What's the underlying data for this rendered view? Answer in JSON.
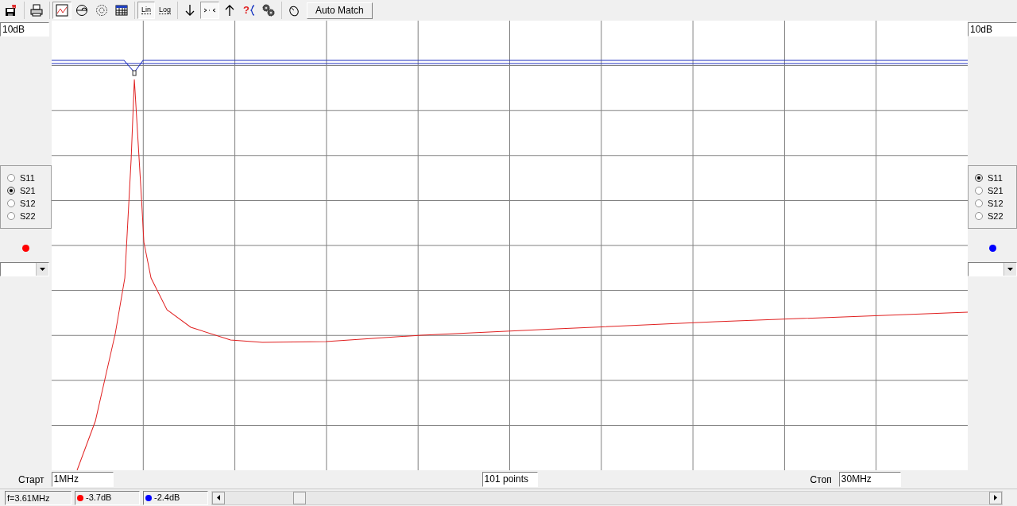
{
  "toolbar": {
    "groups": [
      [
        {
          "kind": "save",
          "selected": false
        }
      ],
      [
        {
          "kind": "print",
          "selected": false
        }
      ],
      [
        {
          "kind": "chart",
          "selected": true
        },
        {
          "kind": "smith",
          "selected": false
        },
        {
          "kind": "polar",
          "selected": false
        },
        {
          "kind": "table",
          "selected": false
        }
      ],
      [
        {
          "kind": "lin",
          "label": "Lin",
          "selected": true
        },
        {
          "kind": "log",
          "label": "Log",
          "selected": false
        }
      ],
      [
        {
          "kind": "down",
          "selected": false
        },
        {
          "kind": "fit",
          "selected": true
        },
        {
          "kind": "up",
          "selected": false
        },
        {
          "kind": "help",
          "label": "?",
          "selected": false
        },
        {
          "kind": "gears",
          "selected": false
        }
      ],
      [
        {
          "kind": "mouse",
          "selected": false
        }
      ]
    ],
    "auto_match": "Auto Match"
  },
  "left_panel": {
    "scale": "10dB",
    "params": [
      {
        "label": "S11",
        "selected": false
      },
      {
        "label": "S21",
        "selected": true
      },
      {
        "label": "S12",
        "selected": false
      },
      {
        "label": "S22",
        "selected": false
      }
    ],
    "color": "#ff0000"
  },
  "right_panel": {
    "scale": "10dB",
    "params": [
      {
        "label": "S11",
        "selected": true
      },
      {
        "label": "S21",
        "selected": false
      },
      {
        "label": "S12",
        "selected": false
      },
      {
        "label": "S22",
        "selected": false
      }
    ],
    "color": "#0000ff"
  },
  "sweep": {
    "start_label": "Старт",
    "start": "1MHz",
    "points": "101 points",
    "stop_label": "Стоп",
    "stop": "30MHz"
  },
  "status": {
    "frequency": "f=3.61MHz",
    "readings": [
      {
        "color": "#ff0000",
        "value": "-3.7dB"
      },
      {
        "color": "#0000ff",
        "value": "-2.4dB"
      }
    ]
  }
}
